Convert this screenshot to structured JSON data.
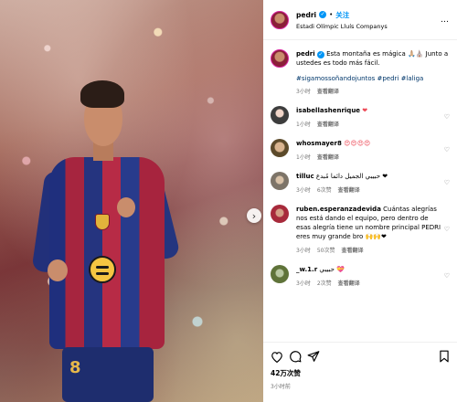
{
  "post": {
    "username": "pedri",
    "separator": "•",
    "follow_label": "关注",
    "location": "Estadi Olímpic Lluís Companys",
    "more_label": "…",
    "next_arrow": "›",
    "jersey_number": "8"
  },
  "caption": {
    "username": "pedri",
    "text": "Esta montaña es mágica 🙏🏼⛪ Junto a ustedes es todo más fácil.",
    "hashtags": "#sigamossoñandojuntos #pedri #laliga",
    "time": "3小时",
    "translate": "查看翻译"
  },
  "comments": [
    {
      "username": "isabellashenrique",
      "text": "❤",
      "time": "1小时",
      "likes": "",
      "translate": "查看翻译"
    },
    {
      "username": "whosmayer8",
      "text": "😍😍😍😍",
      "time": "1小时",
      "likes": "",
      "translate": "查看翻译"
    },
    {
      "username": "tilluc",
      "text": "حبيبي الجميل دائما مُبدع ❤",
      "time": "3小时",
      "likes": "6次赞",
      "translate": "查看翻译"
    },
    {
      "username": "ruben.esperanzadevida",
      "text": "Cuántas alegrías nos está dando el equipo, pero dentro de esas alegría tiene un nombre principal PEDRI eres muy grande bro 🙌🙌❤",
      "time": "3小时",
      "likes": "50次赞",
      "translate": "查看翻译"
    },
    {
      "username": "_w.1.r",
      "text": "حبيبي 💝",
      "time": "3小时",
      "likes": "2次赞",
      "translate": "查看翻译"
    }
  ],
  "footer": {
    "likes": "42万次赞",
    "time": "3小时前"
  },
  "colors": {
    "link_blue": "#0095f6",
    "hashtag_blue": "#00376b",
    "meta_gray": "#737373",
    "heart_red": "#ed4956"
  }
}
